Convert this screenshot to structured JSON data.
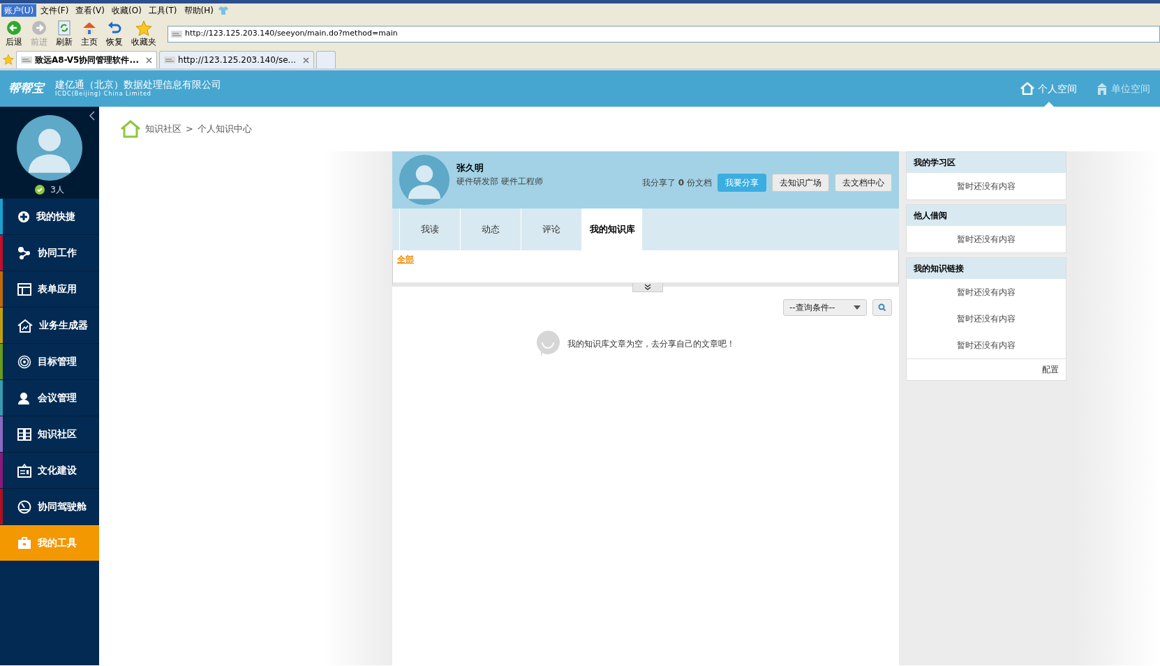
{
  "browser": {
    "menu": [
      {
        "label": "账户(U)",
        "selected": true
      },
      {
        "label": "文件(F)",
        "selected": false
      },
      {
        "label": "查看(V)",
        "selected": false
      },
      {
        "label": "收藏(O)",
        "selected": false
      },
      {
        "label": "工具(T)",
        "selected": false
      },
      {
        "label": "帮助(H)",
        "selected": false
      }
    ],
    "toolbar": [
      {
        "kind": "back",
        "label": "后退",
        "disabled": false
      },
      {
        "kind": "forward",
        "label": "前进",
        "disabled": true
      },
      {
        "kind": "refresh",
        "label": "刷新",
        "disabled": false
      },
      {
        "kind": "home",
        "label": "主页",
        "disabled": false
      },
      {
        "kind": "restore",
        "label": "恢复",
        "disabled": false
      },
      {
        "kind": "favorites",
        "label": "收藏夹",
        "disabled": false
      }
    ],
    "address": "http://123.125.203.140/seeyon/main.do?method=main",
    "tabs": [
      {
        "title": "致远A8-V5协同管理软件...",
        "selected": true
      },
      {
        "title": "http://123.125.203.140/se...",
        "selected": false
      }
    ]
  },
  "header": {
    "logo": "帮帮宝",
    "company": "建亿通（北京）数据处理信息有限公司",
    "company_en": "ICDC(Beijing) China Limited",
    "nav": [
      {
        "kind": "personal",
        "label": "个人空间",
        "selected": true
      },
      {
        "kind": "unit",
        "label": "单位空间",
        "selected": false
      }
    ]
  },
  "sidebar": {
    "online": "3人",
    "items": [
      {
        "kind": "plus",
        "label": "我的快捷",
        "color": "#1aa0d0",
        "selected": false
      },
      {
        "kind": "share",
        "label": "协同工作",
        "color": "#c0102a",
        "selected": false
      },
      {
        "kind": "form",
        "label": "表单应用",
        "color": "#c06a10",
        "selected": false
      },
      {
        "kind": "house",
        "label": "业务生成器",
        "color": "#c0a010",
        "selected": false
      },
      {
        "kind": "target",
        "label": "目标管理",
        "color": "#6a9a20",
        "selected": false
      },
      {
        "kind": "person",
        "label": "会议管理",
        "color": "#3a9ab0",
        "selected": false
      },
      {
        "kind": "book",
        "label": "知识社区",
        "color": "#8a6ac0",
        "selected": false
      },
      {
        "kind": "board",
        "label": "文化建设",
        "color": "#8a1a7a",
        "selected": false
      },
      {
        "kind": "gauge",
        "label": "协同驾驶舱",
        "color": "#b01020",
        "selected": false
      },
      {
        "kind": "toolbox",
        "label": "我的工具",
        "color": "#f39800",
        "selected": true
      }
    ]
  },
  "breadcrumb": [
    "知识社区",
    ">",
    "个人知识中心"
  ],
  "profile": {
    "name": "张久明",
    "position": "硬件研发部 硬件工程师",
    "share_count": "我分享了 **0** 份文档",
    "buttons": [
      {
        "label": "我要分享",
        "kind": "primary"
      },
      {
        "label": "去知识广场",
        "kind": "default"
      },
      {
        "label": "去文档中心",
        "kind": "default"
      }
    ]
  },
  "tabs": [
    {
      "label": "我读",
      "selected": false
    },
    {
      "label": "动态",
      "selected": false
    },
    {
      "label": "评论",
      "selected": false
    },
    {
      "label": "我的知识库",
      "selected": true
    }
  ],
  "filter": "全部",
  "query": "--查询条件--",
  "empty_message": "我的知识库文章为空，去分享自己的文章吧！",
  "panels": [
    {
      "title": "我的学习区",
      "items": [
        "暂时还没有内容"
      ]
    },
    {
      "title": "他人借阅",
      "items": [
        "暂时还没有内容"
      ]
    },
    {
      "title": "我的知识链接",
      "items": [
        "暂时还没有内容",
        "暂时还没有内容",
        "暂时还没有内容"
      ],
      "footer": "配置"
    }
  ]
}
